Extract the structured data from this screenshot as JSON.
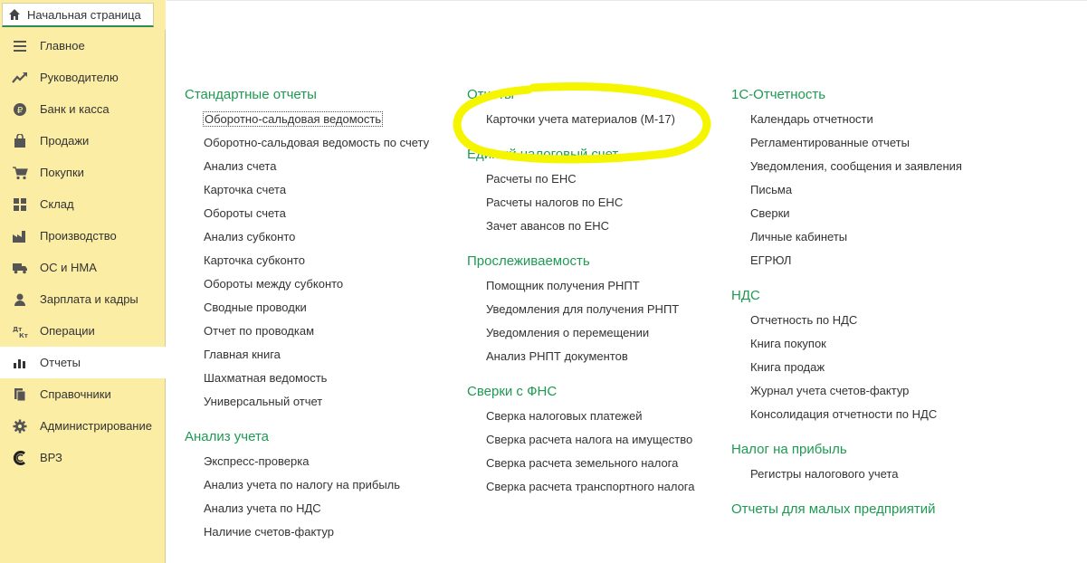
{
  "tab": {
    "label": "Начальная страница"
  },
  "sidebar": {
    "items": [
      {
        "label": "Главное",
        "icon": "menu-lines-icon"
      },
      {
        "label": "Руководителю",
        "icon": "trend-icon"
      },
      {
        "label": "Банк и касса",
        "icon": "ruble-coin-icon"
      },
      {
        "label": "Продажи",
        "icon": "shopping-bag-icon"
      },
      {
        "label": "Покупки",
        "icon": "cart-icon"
      },
      {
        "label": "Склад",
        "icon": "warehouse-grid-icon"
      },
      {
        "label": "Производство",
        "icon": "factory-icon"
      },
      {
        "label": "ОС и НМА",
        "icon": "truck-icon"
      },
      {
        "label": "Зарплата и кадры",
        "icon": "person-icon"
      },
      {
        "label": "Операции",
        "icon": "debit-credit-icon"
      },
      {
        "label": "Отчеты",
        "icon": "bar-chart-icon"
      },
      {
        "label": "Справочники",
        "icon": "books-icon"
      },
      {
        "label": "Администрирование",
        "icon": "gear-icon"
      },
      {
        "label": "ВРЗ",
        "icon": "brand-c-icon"
      }
    ],
    "active_index": 10
  },
  "columns": [
    {
      "sections": [
        {
          "title": "Стандартные отчеты",
          "links": [
            "Оборотно-сальдовая ведомость",
            "Оборотно-сальдовая ведомость по счету",
            "Анализ счета",
            "Карточка счета",
            "Обороты счета",
            "Анализ субконто",
            "Карточка субконто",
            "Обороты между субконто",
            "Сводные проводки",
            "Отчет по проводкам",
            "Главная книга",
            "Шахматная ведомость",
            "Универсальный отчет"
          ]
        },
        {
          "title": "Анализ учета",
          "links": [
            "Экспресс-проверка",
            "Анализ учета по налогу на прибыль",
            "Анализ учета по НДС",
            "Наличие счетов-фактур"
          ]
        }
      ]
    },
    {
      "sections": [
        {
          "title": "Отчеты",
          "links": [
            "Карточки учета материалов (М-17)"
          ]
        },
        {
          "title": "Единый налоговый счет",
          "links": [
            "Расчеты по ЕНС",
            "Расчеты налогов по ЕНС",
            "Зачет авансов по ЕНС"
          ]
        },
        {
          "title": "Прослеживаемость",
          "links": [
            "Помощник получения РНПТ",
            "Уведомления для получения РНПТ",
            "Уведомления о перемещении",
            "Анализ РНПТ документов"
          ]
        },
        {
          "title": "Сверки с ФНС",
          "links": [
            "Сверка налоговых платежей",
            "Сверка расчета налога на имущество",
            "Сверка расчета земельного налога",
            "Сверка расчета транспортного налога"
          ]
        }
      ]
    },
    {
      "sections": [
        {
          "title": "1С-Отчетность",
          "links": [
            "Календарь отчетности",
            "Регламентированные отчеты",
            "Уведомления, сообщения и заявления",
            "Письма",
            "Сверки",
            "Личные кабинеты",
            "ЕГРЮЛ"
          ]
        },
        {
          "title": "НДС",
          "links": [
            "Отчетность по НДС",
            "Книга покупок",
            "Книга продаж",
            "Журнал учета счетов-фактур",
            "Консолидация отчетности по НДС"
          ]
        },
        {
          "title": "Налог на прибыль",
          "links": [
            "Регистры налогового учета"
          ]
        },
        {
          "title": "Отчеты для малых предприятий",
          "links": []
        }
      ]
    }
  ],
  "colors": {
    "sidebar_bg": "#fbeda3",
    "section_title": "#1d9a52",
    "highlight": "#f5f500"
  }
}
